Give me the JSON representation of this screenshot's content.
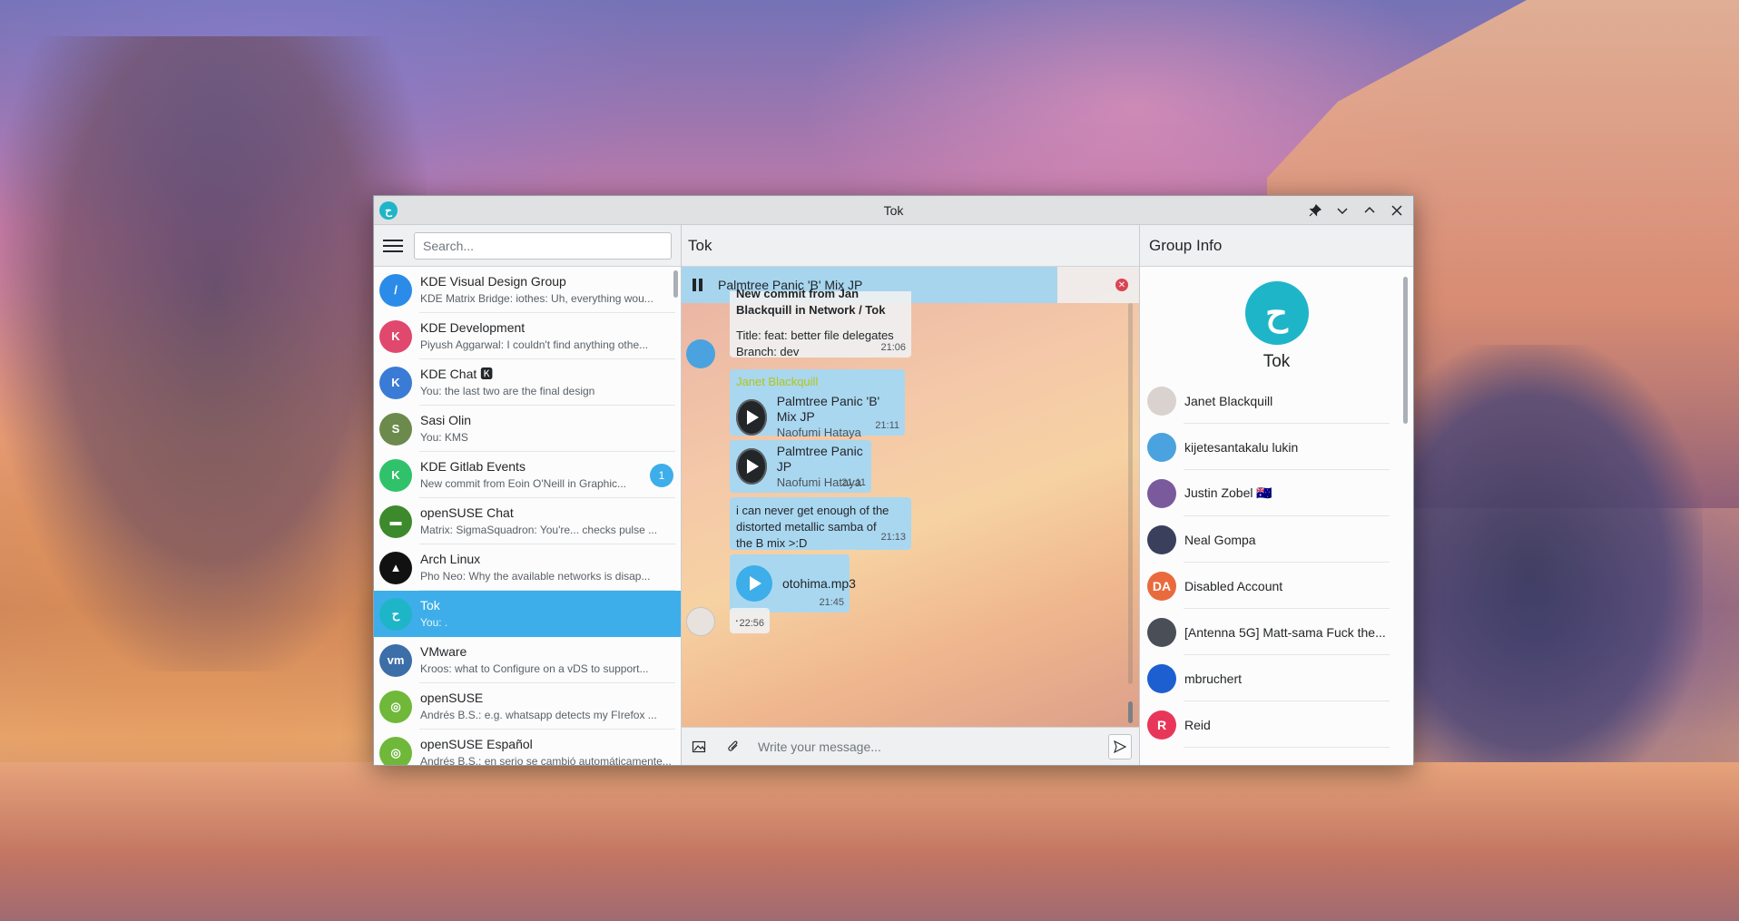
{
  "window": {
    "title": "Tok"
  },
  "search": {
    "placeholder": "Search..."
  },
  "rooms": [
    {
      "name": "KDE Visual Design Group",
      "preview": "KDE Matrix Bridge: iothes: Uh, everything wou...",
      "color": "#2a8ce8",
      "initial": "/"
    },
    {
      "name": "KDE Development",
      "preview": "Piyush Aggarwal: I couldn't find anything othe...",
      "color": "#e0486e",
      "initial": "K"
    },
    {
      "name": "KDE Chat 🅺",
      "preview": "You: the last two are the final design",
      "color": "#3a7bd5",
      "initial": "K"
    },
    {
      "name": "Sasi Olin",
      "preview": "You: KMS",
      "color": "#6d8a4d",
      "initial": "S"
    },
    {
      "name": "KDE Gitlab Events",
      "preview": "New commit from Eoin O'Neill in Graphic...",
      "color": "#2fc26a",
      "initial": "K",
      "badge": "1"
    },
    {
      "name": "openSUSE Chat",
      "preview": "Matrix: SigmaSquadron: You're... checks pulse ...",
      "color": "#3d8a2c",
      "initial": "▬"
    },
    {
      "name": "Arch Linux",
      "preview": "Pho Neo: Why the available networks is disap...",
      "color": "#111111",
      "initial": "▲"
    },
    {
      "name": "Tok",
      "preview": "You: .",
      "color": "#1fb5c8",
      "initial": "ح",
      "active": true
    },
    {
      "name": "VMware",
      "preview": "Kroos: what to Configure on a vDS  to support...",
      "color": "#3c6ea8",
      "initial": "vm"
    },
    {
      "name": "openSUSE",
      "preview": "Andrés B.S.: e.g. whatsapp detects my FIrefox ...",
      "color": "#6fb83a",
      "initial": "◎"
    },
    {
      "name": "openSUSE Español",
      "preview": "Andrés B.S.: en serio se cambió automáticamente...",
      "color": "#6fb83a",
      "initial": "◎"
    }
  ],
  "chat": {
    "title": "Tok",
    "now_playing": "Palmtree Panic 'B' Mix JP",
    "commit": {
      "header": "New commit from Jan Blackquill in Network / Tok",
      "title": "Title: feat: better file delegates",
      "branch": "Branch: dev",
      "time": "21:06"
    },
    "sender": "Janet Blackquill",
    "audio1": {
      "track": "Palmtree Panic 'B' Mix JP",
      "artist": "Naofumi Hataya",
      "time": "21:11"
    },
    "audio2": {
      "track": "Palmtree Panic JP",
      "artist": "Naofumi Hataya",
      "time": "21:11"
    },
    "text_msg": {
      "text": "i can never get enough of the distorted metallic samba of the B mix >:D",
      "time": "21:13"
    },
    "file_msg": {
      "name": "otohima.mp3",
      "time": "21:45"
    },
    "dot_msg": {
      "text": ".",
      "time": "22:56"
    },
    "composer_placeholder": "Write your message..."
  },
  "group_info": {
    "header": "Group Info",
    "name": "Tok",
    "members": [
      {
        "name": "Janet Blackquill",
        "color": "#d9d2cf",
        "initial": ""
      },
      {
        "name": "kijetesantakalu lukin",
        "color": "#4aa3df",
        "initial": ""
      },
      {
        "name": "Justin Zobel 🇦🇺",
        "color": "#7a5a9c",
        "initial": ""
      },
      {
        "name": "Neal Gompa",
        "color": "#3a3f5c",
        "initial": ""
      },
      {
        "name": "Disabled Account",
        "color": "#e96a3c",
        "initial": "DA"
      },
      {
        "name": "[Antenna 5G] Matt-sama Fuck the...",
        "color": "#4a4f57",
        "initial": ""
      },
      {
        "name": "mbruchert",
        "color": "#1d5fd1",
        "initial": ""
      },
      {
        "name": "Reid",
        "color": "#e8365a",
        "initial": "R"
      }
    ]
  },
  "colors": {
    "accent": "#3daee9",
    "tok_brand": "#1fb5c8",
    "sender_name": "#b3c514",
    "danger": "#da4453"
  }
}
